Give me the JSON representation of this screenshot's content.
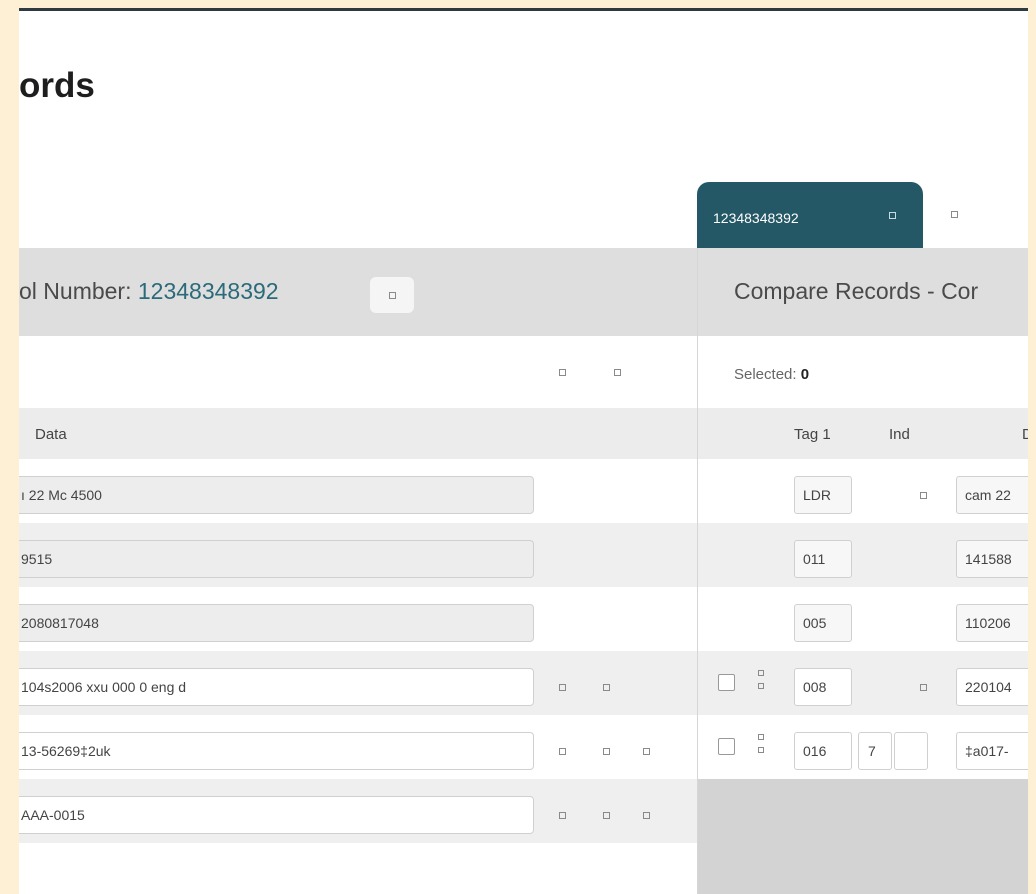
{
  "page": {
    "title_partial": "ords"
  },
  "tabs": {
    "active_label": "12348348392",
    "close_icon": "close-icon",
    "add_icon": "add-tab-icon"
  },
  "left": {
    "header": {
      "prefix": "ol Number: ",
      "number": "12348348392",
      "copy_icon": "copy-icon"
    },
    "columns": {
      "data": "Data"
    },
    "rows": [
      {
        "data": "ı 22   Mc 4500"
      },
      {
        "data": "9515"
      },
      {
        "data": "2080817048"
      },
      {
        "data": "104s2006    xxu          000 0 eng d"
      },
      {
        "data": "13-56269‡2uk"
      },
      {
        "data": "AAA-0015"
      }
    ]
  },
  "right": {
    "header": {
      "title": "Compare Records - Cor"
    },
    "selected": {
      "label": "Selected:",
      "count": "0"
    },
    "columns": {
      "tag": "Tag 1",
      "ind": "Ind",
      "data": "D"
    },
    "rows": [
      {
        "tag": "LDR",
        "ind1": "",
        "ind2": "",
        "data": "cam  22"
      },
      {
        "tag": "011",
        "ind1": "",
        "ind2": "",
        "data": "141588"
      },
      {
        "tag": "005",
        "ind1": "",
        "ind2": "",
        "data": "110206"
      },
      {
        "tag": "008",
        "ind1": "",
        "ind2": "",
        "data": "220104"
      },
      {
        "tag": "016",
        "ind1": "7",
        "ind2": "",
        "data": "‡a017-"
      }
    ]
  },
  "colors": {
    "accent": "#245866",
    "link": "#2a6a7a",
    "header_bg": "#dedede",
    "page_bg": "#fdf0d5"
  }
}
